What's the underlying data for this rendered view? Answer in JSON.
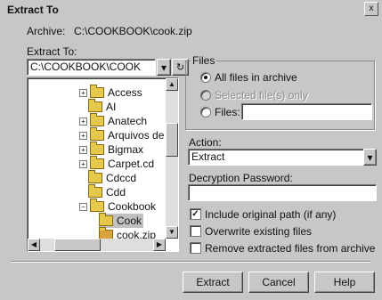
{
  "window": {
    "title": "Extract To",
    "close_glyph": "x"
  },
  "archive": {
    "label": "Archive:",
    "path": "C:\\COOKBOOK\\cook.zip"
  },
  "extract_to": {
    "label": "Extract To:",
    "value": "C:\\COOKBOOK\\COOK"
  },
  "tree": {
    "items": [
      {
        "label": "Access",
        "expandable": true
      },
      {
        "label": "AI",
        "expandable": false
      },
      {
        "label": "Anatech",
        "expandable": true
      },
      {
        "label": "Arquivos de",
        "expandable": true
      },
      {
        "label": "Bigmax",
        "expandable": true
      },
      {
        "label": "Carpet.cd",
        "expandable": true
      },
      {
        "label": "Cdccd",
        "expandable": false
      },
      {
        "label": "Cdd",
        "expandable": false
      },
      {
        "label": "Cookbook",
        "expandable": true
      },
      {
        "label": "Cook",
        "expandable": false
      },
      {
        "label": "cook.zip",
        "expandable": false
      }
    ]
  },
  "files": {
    "group_label": "Files",
    "all": "All files in archive",
    "selected": "Selected file(s) only",
    "files_label": "Files:",
    "files_value": ""
  },
  "action": {
    "label": "Action:",
    "value": "Extract"
  },
  "password": {
    "label": "Decryption Password:",
    "value": ""
  },
  "options": {
    "include_path": "Include original path (if any)",
    "overwrite": "Overwrite existing files",
    "remove": "Remove extracted files from archive"
  },
  "buttons": {
    "extract": "Extract",
    "cancel": "Cancel",
    "help": "Help"
  }
}
